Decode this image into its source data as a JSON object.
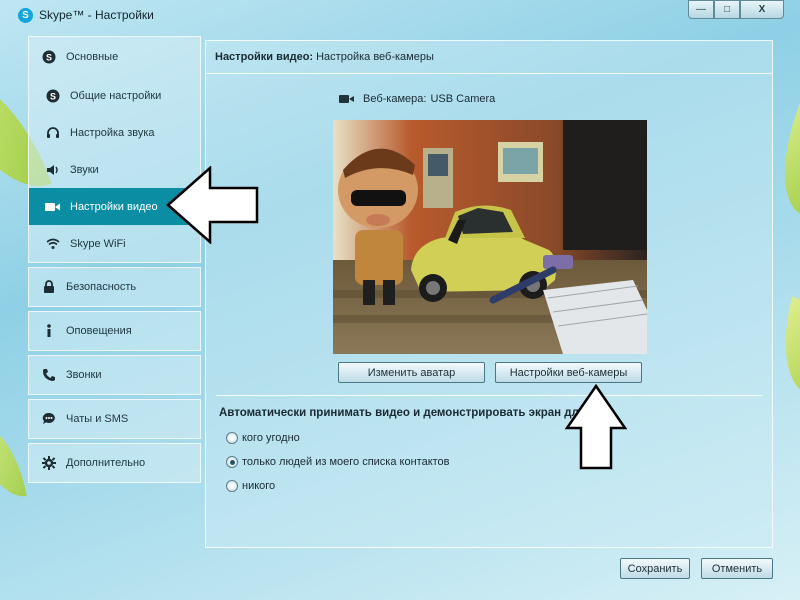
{
  "window": {
    "title": "Skype™ - Настройки",
    "controls": {
      "minimize": "—",
      "maximize": "□",
      "close": "X"
    }
  },
  "sidebar": {
    "groups": [
      {
        "header": {
          "label": "Основные",
          "icon": "skype-icon"
        },
        "items": [
          {
            "label": "Общие настройки",
            "icon": "skype-icon",
            "active": false
          },
          {
            "label": "Настройка звука",
            "icon": "headset-icon",
            "active": false
          },
          {
            "label": "Звуки",
            "icon": "speaker-icon",
            "active": false
          },
          {
            "label": "Настройки видео",
            "icon": "video-camera-icon",
            "active": true
          },
          {
            "label": "Skype WiFi",
            "icon": "wifi-icon",
            "active": false
          }
        ]
      }
    ],
    "sections": [
      {
        "label": "Безопасность",
        "icon": "lock-icon"
      },
      {
        "label": "Оповещения",
        "icon": "info-icon"
      },
      {
        "label": "Звонки",
        "icon": "phone-icon"
      },
      {
        "label": "Чаты и SMS",
        "icon": "chat-icon"
      },
      {
        "label": "Дополнительно",
        "icon": "gear-icon"
      }
    ]
  },
  "main": {
    "header_bold": "Настройки видео:",
    "header_rest": "Настройка веб-камеры",
    "webcam_label": "Веб-камера:",
    "webcam_value": "USB Camera",
    "change_avatar_button": "Изменить аватар",
    "webcam_settings_button": "Настройки веб-камеры",
    "auto_accept_title": "Автоматически принимать видео и демонстрировать экран для",
    "radio_options": [
      {
        "label": "кого угодно",
        "checked": false
      },
      {
        "label": "только людей из моего списка контактов",
        "checked": true
      },
      {
        "label": "никого",
        "checked": false
      }
    ]
  },
  "footer": {
    "save_button": "Сохранить",
    "cancel_button": "Отменить"
  },
  "colors": {
    "accent": "#0b8ea3",
    "skype_blue": "#12a5e0"
  }
}
